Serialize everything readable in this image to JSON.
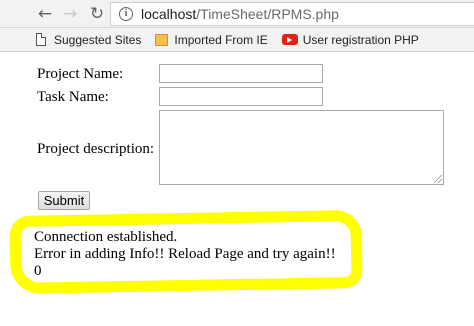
{
  "browser": {
    "url_host": "localhost",
    "url_path": "/TimeSheet/RPMS.php",
    "bookmarks": [
      {
        "label": "Suggested Sites",
        "icon": "page-icon"
      },
      {
        "label": "Imported From IE",
        "icon": "folder-icon"
      },
      {
        "label": "User registration PHP",
        "icon": "youtube-icon"
      }
    ]
  },
  "form": {
    "project_name_label": "Project Name:",
    "task_name_label": "Task Name:",
    "project_description_label": "Project description:",
    "project_name_value": "",
    "task_name_value": "",
    "project_description_value": "",
    "submit_label": "Submit"
  },
  "output": {
    "line1": "Connection established.",
    "line2": "Error in adding Info!! Reload Page and try again!!",
    "line3": "0",
    "highlight_color": "#ffff00"
  }
}
